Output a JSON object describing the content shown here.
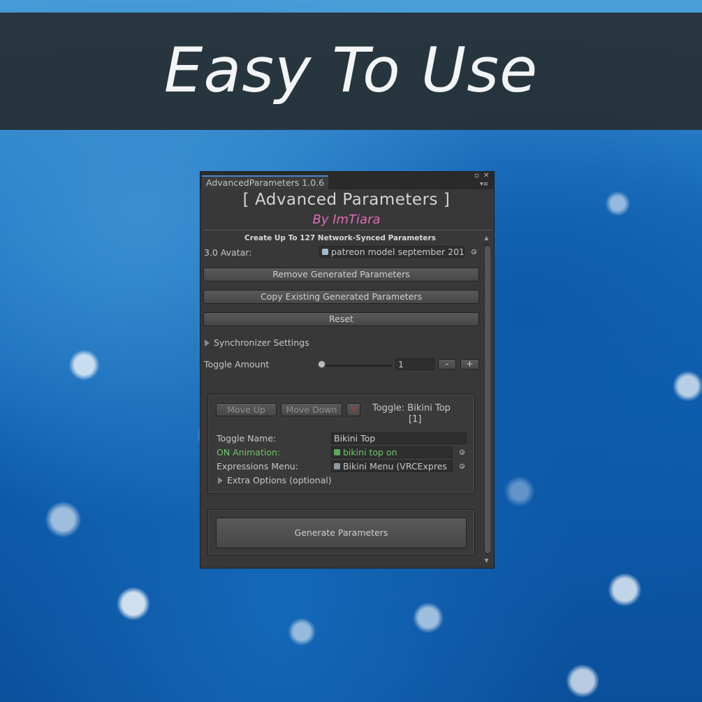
{
  "banner": {
    "title": "Easy To Use"
  },
  "window": {
    "tab_title": "AdvancedParameters 1.0.6",
    "header_title": "[ Advanced Parameters ]",
    "header_subtitle": "By ImTiara",
    "description": "Create Up To 127 Network-Synced Parameters",
    "avatar_label": "3.0 Avatar:",
    "avatar_value": "patreon model september 201",
    "buttons": {
      "remove": "Remove Generated Parameters",
      "copy": "Copy Existing Generated Parameters",
      "reset": "Reset",
      "generate": "Generate Parameters"
    },
    "sync_settings_label": "Synchronizer Settings",
    "toggle_amount_label": "Toggle Amount",
    "toggle_amount_value": "1",
    "slider_fraction": 0,
    "minus_label": "-",
    "plus_label": "+",
    "toggle": {
      "move_up": "Move Up",
      "move_down": "Move Down",
      "remove_symbol": "X",
      "heading_line1": "Toggle: Bikini Top",
      "heading_line2": "[1]",
      "name_label": "Toggle Name:",
      "name_value": "Bikini Top",
      "on_anim_label": "ON Animation:",
      "on_anim_value": "bikini top on",
      "menu_label": "Expressions Menu:",
      "menu_value": "Bikini Menu (VRCExpres",
      "extra_options": "Extra Options (optional)"
    },
    "colors": {
      "accent_pink": "#e16bb5",
      "on_animation_green": "#6fc56a",
      "tab_accent": "#4b86c8"
    }
  }
}
